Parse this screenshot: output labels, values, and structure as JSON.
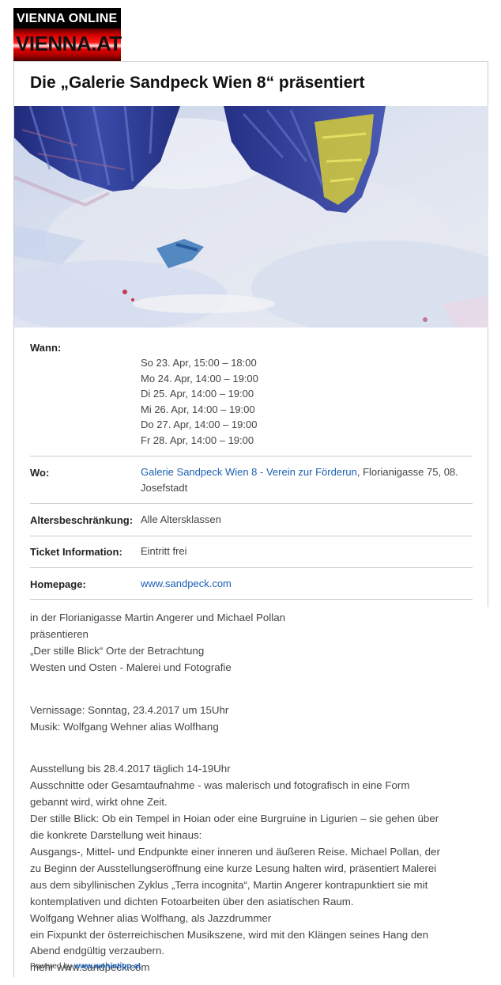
{
  "logo": {
    "line1": "VIENNA ONLINE",
    "line2": "VIENNA.AT"
  },
  "event": {
    "title": "Die „Galerie Sandpeck Wien 8“ präsentiert",
    "image_alt": "Abstraktes Gemälde in Blau und Gelb"
  },
  "details": {
    "wann_label": "Wann:",
    "dates": [
      "So 23. Apr, 15:00 – 18:00",
      "Mo 24. Apr, 14:00 – 19:00",
      "Di 25. Apr, 14:00 – 19:00",
      "Mi 26. Apr, 14:00 – 19:00",
      "Do 27. Apr, 14:00 – 19:00",
      "Fr 28. Apr, 14:00 – 19:00"
    ],
    "wo_label": "Wo:",
    "venue_link": "Galerie Sandpeck Wien 8 - Verein zur Förderun",
    "venue_address_1": ", Florianigasse 75, 08.",
    "venue_address_2": "Josefstadt",
    "age_label": "Altersbeschränkung:",
    "age_value": "Alle Altersklassen",
    "ticket_label": "Ticket Information:",
    "ticket_value": "Eintritt frei",
    "homepage_label": "Homepage:",
    "homepage_link": "www.sandpeck.com"
  },
  "description": {
    "p1": [
      "in der Florianigasse Martin Angerer und Michael Pollan",
      "präsentieren",
      "„Der stille Blick“ Orte der Betrachtung",
      "Westen und Osten - Malerei und Fotografie"
    ],
    "p2": [
      "Vernissage: Sonntag, 23.4.2017 um 15Uhr",
      "Musik: Wolfgang Wehner alias Wolfhang"
    ],
    "p3": [
      "Ausstellung bis 28.4.2017 täglich 14-19Uhr",
      "Ausschnitte oder Gesamtaufnahme - was malerisch und fotografisch in eine Form",
      "gebannt wird, wirkt ohne Zeit.",
      "Der stille Blick: Ob ein Tempel in Hoian oder eine Burgruine in Ligurien – sie gehen über",
      "die konkrete Darstellung weit hinaus:",
      "Ausgangs-, Mittel- und Endpunkte einer inneren und äußeren Reise. Michael Pollan, der",
      "zu Beginn der Ausstellungseröffnung eine kurze Lesung halten wird, präsentiert Malerei",
      "aus dem sibyllinischen Zyklus „Terra incognita“, Martin Angerer kontrapunktiert sie mit",
      "kontemplativen und dichten Fotoarbeiten über den asiatischen Raum.",
      "Wolfgang Wehner alias Wolfhang, als Jazzdrummer",
      "ein Fixpunkt der österreichischen Musikszene, wird mit den Klängen seines Hang den",
      "Abend endgültig verzaubern.",
      "mehr www.sandpeck.com"
    ]
  },
  "footer": {
    "powered_text": "Powered by",
    "powered_link": "www.wohintipp.at"
  },
  "colors": {
    "link": "#1a5fb4",
    "separator": "#cccccc",
    "logo_red": "#d40000"
  }
}
